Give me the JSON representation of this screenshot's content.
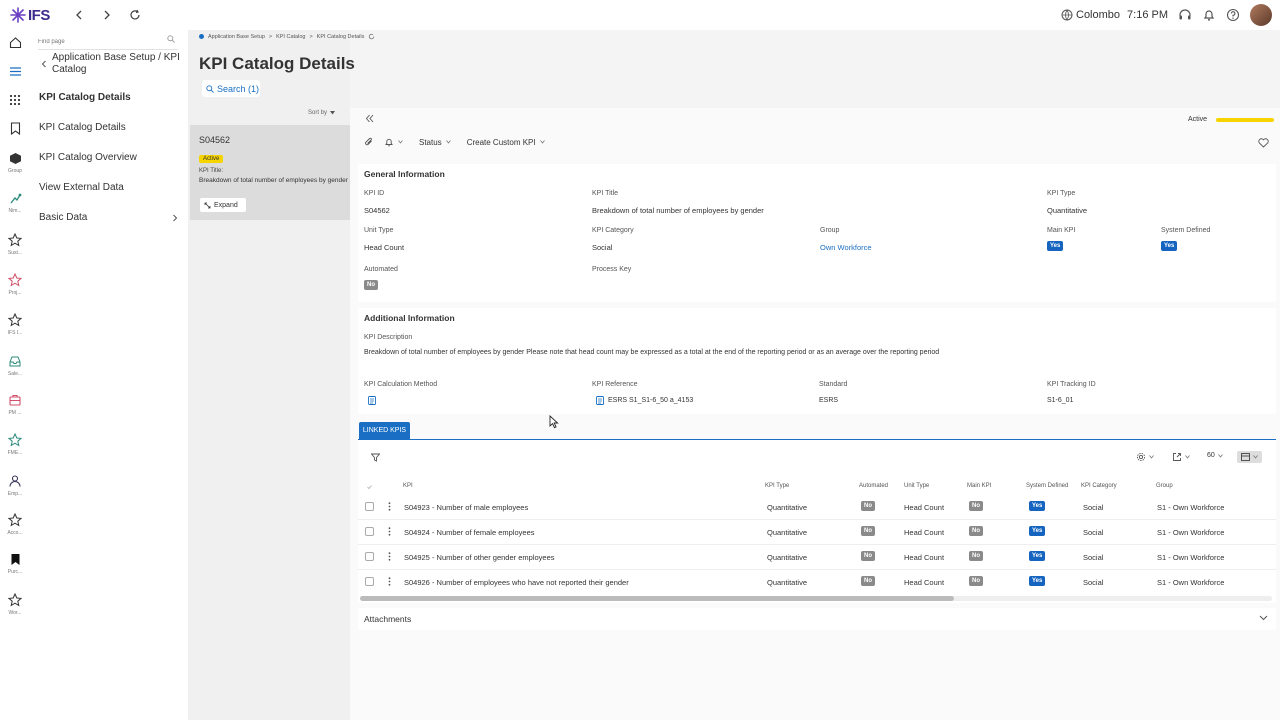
{
  "app": {
    "logo": "IFS"
  },
  "topbar": {
    "location": "Colombo",
    "time": "7:16 PM"
  },
  "rail": {
    "items": [
      {
        "icon": "home-icon",
        "label": ""
      },
      {
        "icon": "menu-icon",
        "label": ""
      },
      {
        "icon": "apps-grid-icon",
        "label": ""
      },
      {
        "icon": "bookmark-icon",
        "label": ""
      },
      {
        "icon": "cube-icon",
        "label": "Group"
      },
      {
        "icon": "flow-icon",
        "label": "Nim..."
      },
      {
        "icon": "star-icon",
        "label": "Sust..."
      },
      {
        "icon": "star-icon",
        "label": "Proj..."
      },
      {
        "icon": "star-icon",
        "label": "IFS I..."
      },
      {
        "icon": "inbox-icon",
        "label": "Sale..."
      },
      {
        "icon": "case-icon",
        "label": "PM ..."
      },
      {
        "icon": "star-icon",
        "label": "FME..."
      },
      {
        "icon": "people-icon",
        "label": "Emp..."
      },
      {
        "icon": "star-icon",
        "label": "Acco..."
      },
      {
        "icon": "bookmark-filled-icon",
        "label": "Purc..."
      },
      {
        "icon": "star-icon",
        "label": "Wor..."
      }
    ]
  },
  "navigator": {
    "find_placeholder": "Find page",
    "crumb": "Application Base Setup / KPI Catalog",
    "items": [
      {
        "label": "KPI Catalog Details"
      },
      {
        "label": "KPI Catalog Details"
      },
      {
        "label": "KPI Catalog Overview"
      },
      {
        "label": "View External Data"
      },
      {
        "label": "Basic Data"
      }
    ]
  },
  "breadcrumb": {
    "items": [
      "Application Base Setup",
      "KPI Catalog",
      "KPI Catalog Details"
    ]
  },
  "page": {
    "title": "KPI Catalog Details",
    "search_label": "Search (1)",
    "sort_label": "Sort by"
  },
  "record": {
    "id": "S04562",
    "status": "Active",
    "title_label": "KPI Title:",
    "title_value": "Breakdown of total number of employees by gender",
    "expand_label": "Expand"
  },
  "state": {
    "label": "Active",
    "color": "#f5d400"
  },
  "toolbar": {
    "status_label": "Status",
    "create_label": "Create Custom KPI"
  },
  "general": {
    "title": "General Information",
    "kpi_id_label": "KPI ID",
    "kpi_id": "S04562",
    "kpi_title_label": "KPI Title",
    "kpi_title": "Breakdown of total number of employees by gender",
    "kpi_type_label": "KPI Type",
    "kpi_type": "Quantitative",
    "unit_type_label": "Unit Type",
    "unit_type": "Head Count",
    "kpi_category_label": "KPI Category",
    "kpi_category": "Social",
    "group_label": "Group",
    "group": "Own Workforce",
    "main_kpi_label": "Main KPI",
    "main_kpi": "Yes",
    "system_defined_label": "System Defined",
    "system_defined": "Yes",
    "automated_label": "Automated",
    "automated": "No",
    "process_key_label": "Process Key"
  },
  "additional": {
    "title": "Additional Information",
    "desc_label": "KPI Description",
    "desc": "Breakdown of total number of employees by gender Please note that head count may be expressed as a total at the end of the reporting period or as an average over the reporting period",
    "calc_label": "KPI Calculation Method",
    "reference_label": "KPI Reference",
    "reference": "ESRS S1_S1-6_50 a_4153",
    "standard_label": "Standard",
    "standard": "ESRS",
    "tracking_label": "KPI Tracking ID",
    "tracking": "S1-6_01"
  },
  "linked": {
    "tab_label": "LINKED KPIS",
    "page_size": "60",
    "columns": [
      "KPI",
      "KPI Type",
      "Automated",
      "Unit Type",
      "Main KPI",
      "System Defined",
      "KPI Category",
      "Group"
    ],
    "rows": [
      {
        "kpi": "S04923 - Number of male employees",
        "type": "Quantitative",
        "automated": "No",
        "unit": "Head Count",
        "main": "No",
        "system": "Yes",
        "category": "Social",
        "group": "S1 - Own Workforce"
      },
      {
        "kpi": "S04924 - Number of female employees",
        "type": "Quantitative",
        "automated": "No",
        "unit": "Head Count",
        "main": "No",
        "system": "Yes",
        "category": "Social",
        "group": "S1 - Own Workforce"
      },
      {
        "kpi": "S04925 - Number of other gender employees",
        "type": "Quantitative",
        "automated": "No",
        "unit": "Head Count",
        "main": "No",
        "system": "Yes",
        "category": "Social",
        "group": "S1 - Own Workforce"
      },
      {
        "kpi": "S04926 - Number of employees who have not reported their gender",
        "type": "Quantitative",
        "automated": "No",
        "unit": "Head Count",
        "main": "No",
        "system": "Yes",
        "category": "Social",
        "group": "S1 - Own Workforce"
      }
    ]
  },
  "attachments": {
    "title": "Attachments"
  },
  "colors": {
    "accent": "#1a6fc4",
    "yes": "#1565c0",
    "no": "#8a8a8a",
    "active": "#f5d400"
  }
}
